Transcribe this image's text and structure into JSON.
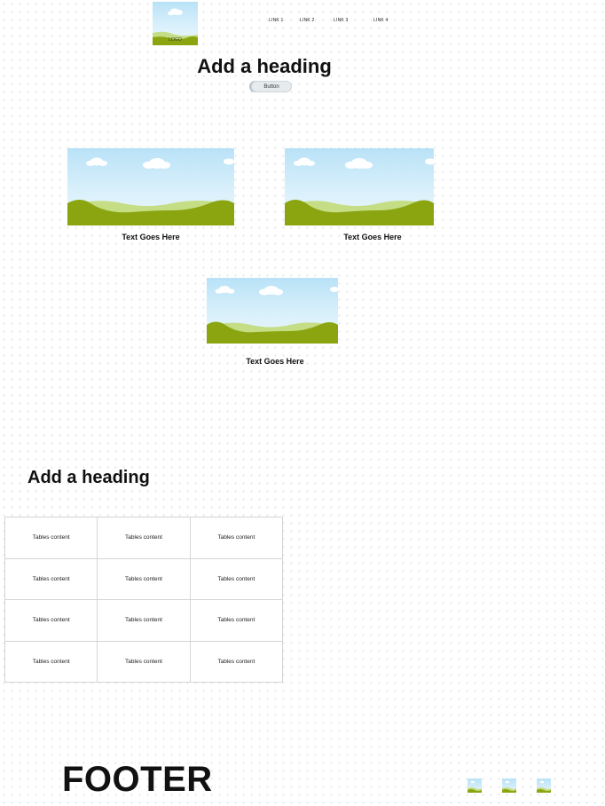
{
  "header": {
    "logo_label": "LOGO",
    "nav_links": [
      "LINK 1",
      "LINK 2",
      "LINK 3",
      "LINK 4"
    ]
  },
  "hero": {
    "heading": "Add a heading",
    "button_label": "Button"
  },
  "cards": [
    {
      "caption": "Text Goes Here"
    },
    {
      "caption": "Text Goes Here"
    },
    {
      "caption": "Text Goes Here"
    }
  ],
  "section": {
    "heading": "Add a heading"
  },
  "table": {
    "rows": [
      [
        "Tables content",
        "Tables content",
        "Tables content"
      ],
      [
        "Tables content",
        "Tables content",
        "Tables content"
      ],
      [
        "Tables content",
        "Tables content",
        "Tables content"
      ],
      [
        "Tables content",
        "Tables content",
        "Tables content"
      ]
    ]
  },
  "footer": {
    "title": "FOOTER",
    "icons": [
      "image-placeholder-icon",
      "image-placeholder-icon",
      "image-placeholder-icon"
    ]
  },
  "colors": {
    "sky_top": "#b9e2f7",
    "hill_dark": "#8aa50f",
    "hill_light": "#c5dd85"
  }
}
